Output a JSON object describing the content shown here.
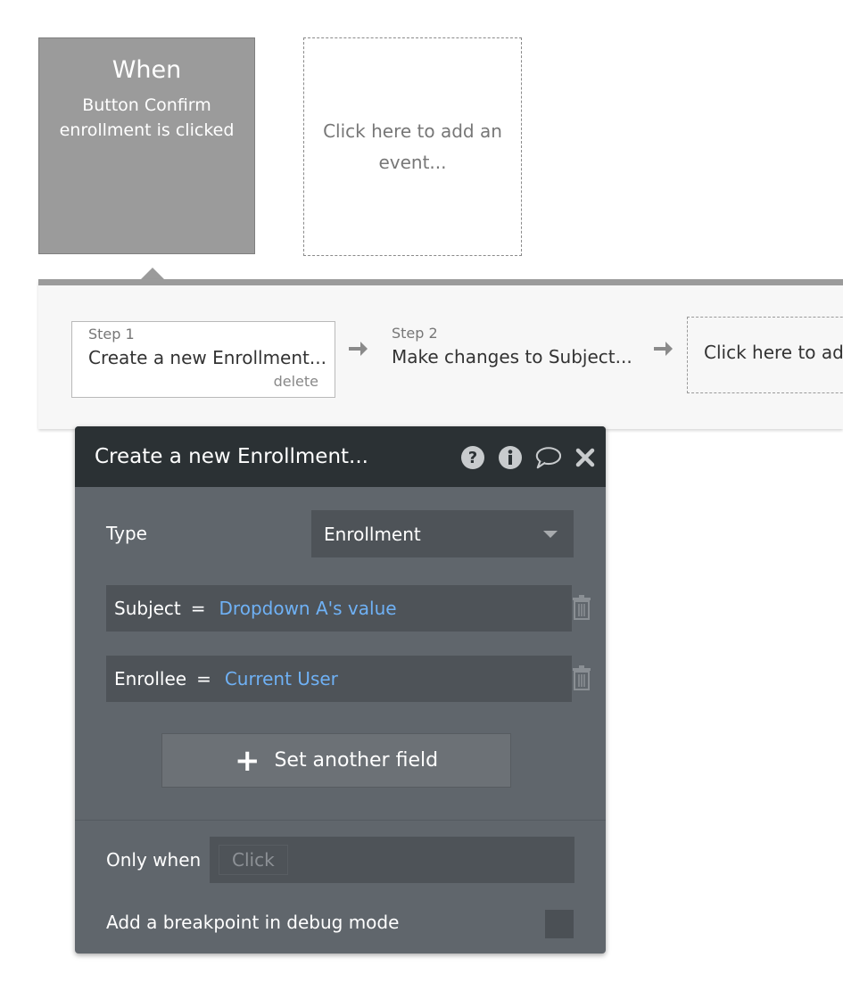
{
  "event": {
    "when_label": "When",
    "description": "Button Confirm enrollment is clicked",
    "add_event_placeholder": "Click here to add an event..."
  },
  "actions": {
    "steps": [
      {
        "step_label": "Step 1",
        "title": "Create a new Enrollment...",
        "delete_label": "delete"
      },
      {
        "step_label": "Step 2",
        "title": "Make changes to Subject..."
      }
    ],
    "add_action_placeholder": "Click here to add"
  },
  "editor": {
    "title": "Create a new Enrollment...",
    "icons": [
      "help-icon",
      "info-icon",
      "comment-icon",
      "close-icon"
    ],
    "type_label": "Type",
    "type_value": "Enrollment",
    "fields": [
      {
        "name": "Subject",
        "operator": "=",
        "value": "Dropdown A's value"
      },
      {
        "name": "Enrollee",
        "operator": "=",
        "value": "Current User"
      }
    ],
    "set_another_field_label": "Set another field",
    "only_when_label": "Only when",
    "only_when_placeholder": "Click",
    "breakpoint_label": "Add a breakpoint in debug mode",
    "dynamic_value_color": "#6fb1f5"
  }
}
